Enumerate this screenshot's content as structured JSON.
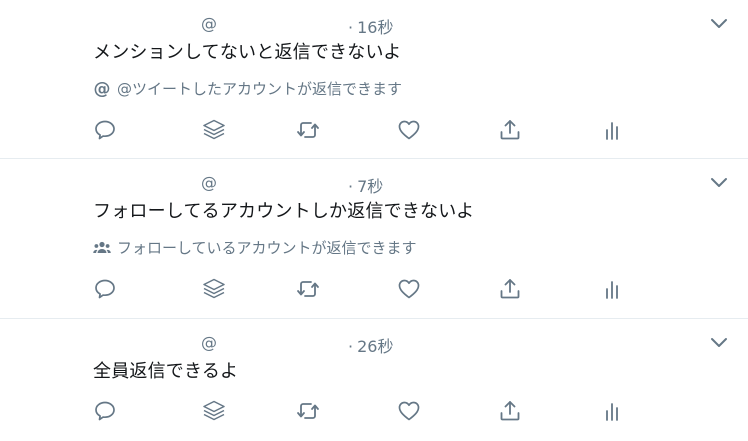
{
  "tweets": [
    {
      "handle": "@",
      "dot": "·",
      "time": "16秒",
      "text": "メンションしてないと返信できないよ",
      "reply_restriction": {
        "icon": "at-icon",
        "text": "@ツイートしたアカウントが返信できます"
      }
    },
    {
      "handle": "@",
      "dot": "·",
      "time": "7秒",
      "text": "フォローしてるアカウントしか返信できないよ",
      "reply_restriction": {
        "icon": "people-icon",
        "text": "フォローしているアカウントが返信できます"
      }
    },
    {
      "handle": "@",
      "dot": "·",
      "time": "26秒",
      "text": "全員返信できるよ"
    }
  ],
  "actions": [
    "reply-icon",
    "stack-icon",
    "retweet-icon",
    "like-icon",
    "share-icon",
    "analytics-icon"
  ],
  "colors": {
    "text_primary": "#14171a",
    "text_secondary": "#657786",
    "divider": "#e6ecf0",
    "background": "#ffffff"
  }
}
